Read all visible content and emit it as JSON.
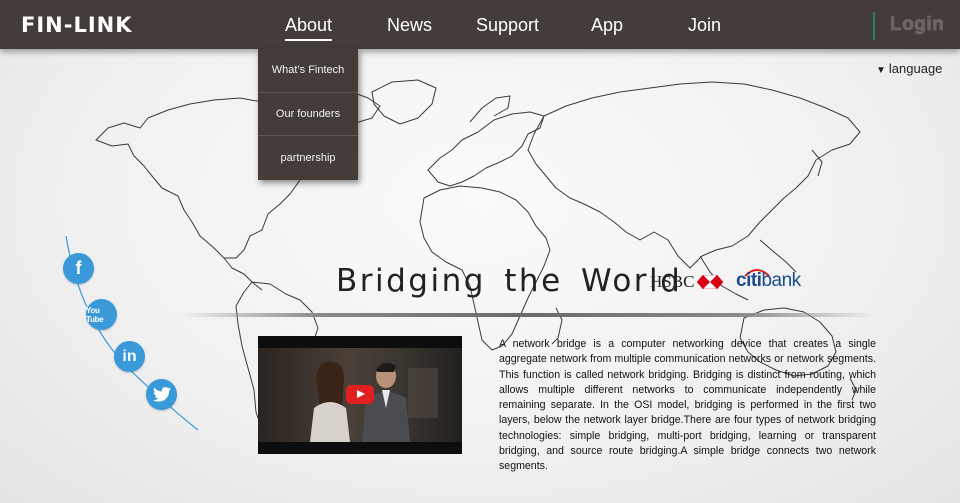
{
  "brand": {
    "logo": "FIN-LINK"
  },
  "nav": {
    "items": [
      {
        "label": "About",
        "active": true
      },
      {
        "label": "News"
      },
      {
        "label": "Support"
      },
      {
        "label": "App"
      },
      {
        "label": "Join"
      }
    ],
    "login": "Login"
  },
  "about_menu": [
    "What’s Fintech",
    "Our founders",
    "partnership"
  ],
  "language": {
    "label": "language",
    "icon": "triangle-down-icon"
  },
  "hero": {
    "headline": "Bridging the World",
    "partners": {
      "hsbc": "HSBC",
      "citi": "citi",
      "citi_suffix": "bank"
    }
  },
  "video": {
    "play_icon": "play-icon",
    "platform": "YouTube"
  },
  "description": "A network bridge is a computer networking device that creates a single aggregate network from multiple communication networks or network segments. This function is called network bridging. Bridging is distinct from routing, which allows multiple different networks to communicate independently while remaining separate. In the OSI model, bridging is performed in the first two layers, below the network layer bridge.There are four types of network bridging technologies: simple bridging, multi-port bridging, learning or transparent bridging, and source route bridging.A simple bridge connects two network segments.",
  "social": {
    "facebook": "f",
    "youtube": "You Tube",
    "linkedin": "in",
    "twitter_icon": "twitter-bird-icon"
  },
  "colors": {
    "topbar": "#433c39",
    "social": "#3a9ad9",
    "hsbc_red": "#db0011",
    "citi_blue": "#1c4c8c",
    "citi_arc": "#e2231a"
  }
}
